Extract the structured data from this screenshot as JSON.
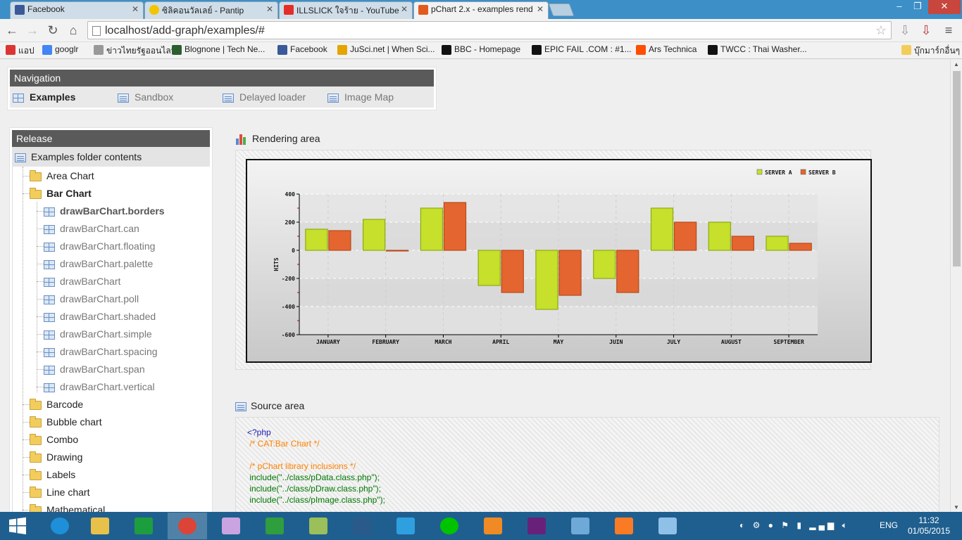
{
  "browser": {
    "tabs": [
      {
        "title": "Facebook",
        "color": "#3b5998"
      },
      {
        "title": "ซิลิคอนวัลเลย์ - Pantip",
        "color": "#f2c500"
      },
      {
        "title": "ILLSLICK ใจร้าย - YouTube",
        "color": "#e52d27"
      },
      {
        "title": "pChart 2.x - examples rend",
        "color": "#e25a1c"
      }
    ],
    "window_controls": [
      "‒",
      "❐",
      "✕"
    ],
    "url": "localhost/add-graph/examples/#",
    "bookmarks": [
      {
        "label": "แอป",
        "icon": "apps-icon",
        "color": "#d33"
      },
      {
        "label": "googlr",
        "icon": "google-icon",
        "color": "#4285f4"
      },
      {
        "label": "ข่าวไทยรัฐออนไลน์",
        "icon": "thairath-icon",
        "color": "#999"
      },
      {
        "label": "Blognone | Tech Ne...",
        "icon": "blognone-icon",
        "color": "#2c5e2e"
      },
      {
        "label": "Facebook",
        "icon": "facebook-icon",
        "color": "#3b5998"
      },
      {
        "label": "JuSci.net | When Sci...",
        "icon": "jusci-icon",
        "color": "#e4a500"
      },
      {
        "label": "BBC - Homepage",
        "icon": "bbc-icon",
        "color": "#111"
      },
      {
        "label": "EPIC FAIL .COM : #1...",
        "icon": "epicfail-icon",
        "color": "#111"
      },
      {
        "label": "Ars Technica",
        "icon": "ars-icon",
        "color": "#ff4e00"
      },
      {
        "label": "TWCC : Thai Washer...",
        "icon": "twcc-icon",
        "color": "#111"
      }
    ],
    "other_bookmarks": "บุ๊กมาร์กอื่นๆ"
  },
  "navigation": {
    "title": "Navigation",
    "items": [
      "Examples",
      "Sandbox",
      "Delayed loader",
      "Image Map"
    ]
  },
  "release": {
    "title": "Release",
    "folder_header": "Examples folder contents",
    "folders_before": [
      "Area Chart"
    ],
    "open_folder": "Bar Chart",
    "scripts": [
      "drawBarChart.borders",
      "drawBarChart.can",
      "drawBarChart.floating",
      "drawBarChart.palette",
      "drawBarChart",
      "drawBarChart.poll",
      "drawBarChart.shaded",
      "drawBarChart.simple",
      "drawBarChart.spacing",
      "drawBarChart.span",
      "drawBarChart.vertical"
    ],
    "folders_after": [
      "Barcode",
      "Bubble chart",
      "Combo",
      "Drawing",
      "Labels",
      "Line chart",
      "Mathematical"
    ]
  },
  "rendering_area": {
    "title": "Rendering area"
  },
  "source_area": {
    "title": "Source area",
    "lines": [
      {
        "text": "<?php",
        "color": "#1c1cb8"
      },
      {
        "text": " /* CAT:Bar Chart */",
        "color": "#ff8000"
      },
      {
        "text": "",
        "color": "#000"
      },
      {
        "text": " /* pChart library inclusions */",
        "color": "#ff8000"
      },
      {
        "text": " include(\"../class/pData.class.php\");",
        "color": "#007700"
      },
      {
        "text": " include(\"../class/pDraw.class.php\");",
        "color": "#007700"
      },
      {
        "text": " include(\"../class/pImage.class.php\");",
        "color": "#007700"
      }
    ]
  },
  "chart_data": {
    "type": "bar",
    "categories": [
      "JANUARY",
      "FEBRUARY",
      "MARCH",
      "APRIL",
      "MAY",
      "JUIN",
      "JULY",
      "AUGUST",
      "SEPTEMBER"
    ],
    "series": [
      {
        "name": "SERVER A",
        "color": "#c6e02b",
        "values": [
          150,
          220,
          300,
          -250,
          -420,
          -200,
          300,
          200,
          100
        ]
      },
      {
        "name": "SERVER B",
        "color": "#e4652f",
        "values": [
          140,
          0,
          340,
          -300,
          -320,
          -300,
          200,
          100,
          50
        ]
      }
    ],
    "ylabel": "HITS",
    "yticks": [
      "400",
      "200",
      "0",
      "-200",
      "-400",
      "-600"
    ],
    "ylim": [
      -600,
      400
    ],
    "grid": true,
    "legend_position": "top-right"
  },
  "taskbar": {
    "apps": [
      {
        "name": "internet-explorer-icon",
        "color": "#1e8fd9"
      },
      {
        "name": "file-explorer-icon",
        "color": "#e8c14a"
      },
      {
        "name": "store-icon",
        "color": "#1d9e3e"
      },
      {
        "name": "chrome-icon",
        "color": "#db4437"
      },
      {
        "name": "paint-icon",
        "color": "#c9a4e0"
      },
      {
        "name": "calculator-icon",
        "color": "#2e9e3e"
      },
      {
        "name": "notepad-plus-icon",
        "color": "#9bbf5a"
      },
      {
        "name": "mysql-workbench-icon",
        "color": "#2a5a8a"
      },
      {
        "name": "network-icon",
        "color": "#2ea0e0"
      },
      {
        "name": "line-icon",
        "color": "#00c300"
      },
      {
        "name": "media-player-icon",
        "color": "#f08a24"
      },
      {
        "name": "visual-studio-icon",
        "color": "#68217a"
      },
      {
        "name": "remote-desktop-icon",
        "color": "#6fa9d8"
      },
      {
        "name": "xampp-icon",
        "color": "#fb7a24"
      },
      {
        "name": "control-panel-icon",
        "color": "#8fc1e8"
      }
    ],
    "lang": "ENG",
    "time": "11:32",
    "date": "01/05/2015"
  }
}
